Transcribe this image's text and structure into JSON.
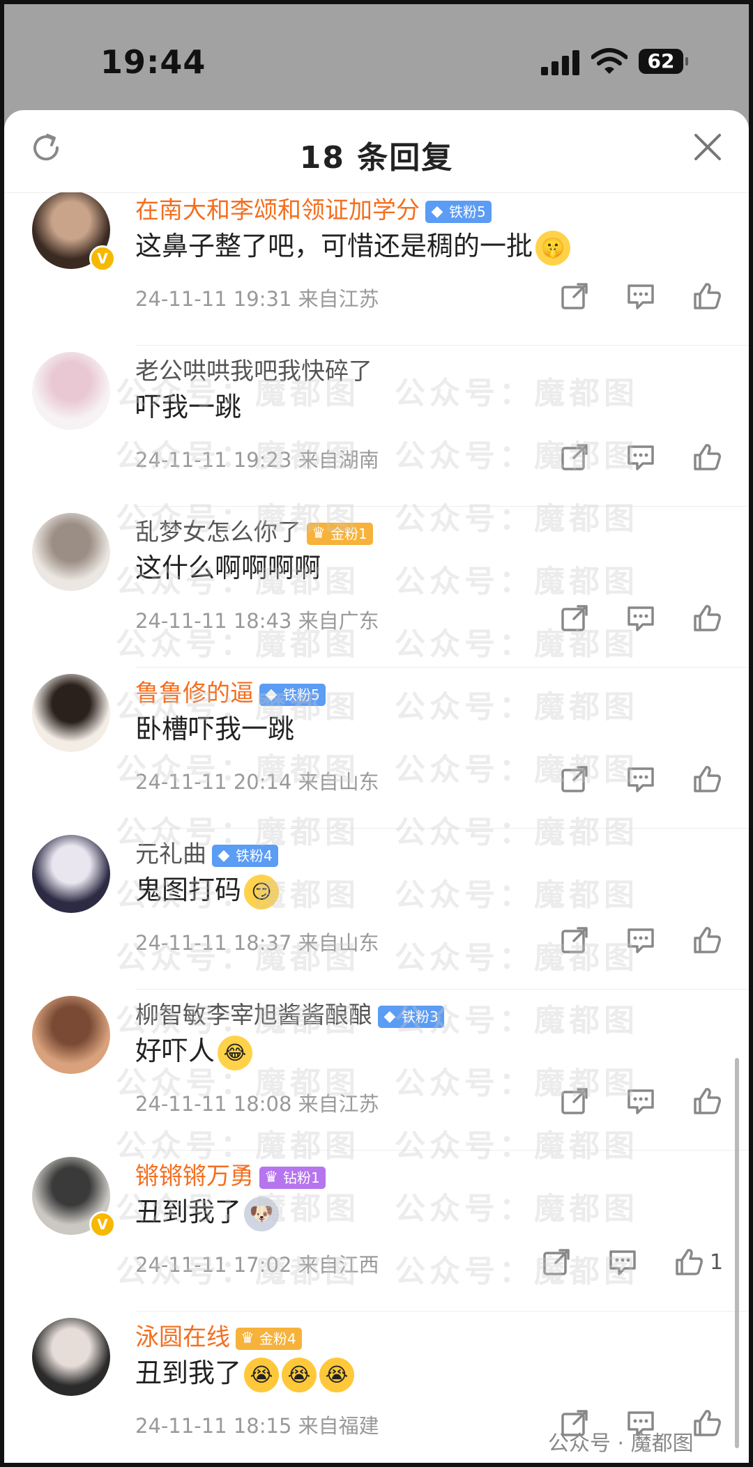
{
  "status_bar": {
    "time": "19:44",
    "battery": "62"
  },
  "sheet": {
    "title": "18 条回复"
  },
  "comments": [
    {
      "name": "在南大和李颂和领证加学分",
      "name_color": "orange",
      "badge": "铁粉5",
      "badge_style": "blue",
      "verified": true,
      "text": "这鼻子整了吧，可惜还是稠的一批",
      "emojis": [
        "shush-emoji"
      ],
      "time": "24-11-11 19:31",
      "location": "来自江苏",
      "likes": ""
    },
    {
      "name": "老公哄哄我吧我快碎了",
      "name_color": "gray",
      "badge": "",
      "badge_style": "",
      "verified": false,
      "text": "吓我一跳",
      "emojis": [],
      "time": "24-11-11 19:23",
      "location": "来自湖南",
      "likes": ""
    },
    {
      "name": "乱梦女怎么你了",
      "name_color": "gray",
      "badge": "金粉1",
      "badge_style": "gold",
      "verified": false,
      "text": "这什么啊啊啊啊",
      "emojis": [],
      "time": "24-11-11 18:43",
      "location": "来自广东",
      "likes": ""
    },
    {
      "name": "鲁鲁修的逼",
      "name_color": "orange",
      "badge": "铁粉5",
      "badge_style": "blue",
      "verified": false,
      "text": "卧槽吓我一跳",
      "emojis": [],
      "time": "24-11-11 20:14",
      "location": "来自山东",
      "likes": ""
    },
    {
      "name": "元礼曲",
      "name_color": "gray",
      "badge": "铁粉4",
      "badge_style": "blue",
      "verified": false,
      "text": "鬼图打码",
      "emojis": [
        "smirk-emoji"
      ],
      "time": "24-11-11 18:37",
      "location": "来自山东",
      "likes": ""
    },
    {
      "name": "柳智敏李宰旭酱酱酿酿",
      "name_color": "gray",
      "badge": "铁粉3",
      "badge_style": "blue",
      "verified": false,
      "text": "好吓人",
      "emojis": [
        "laugh-cry-emoji"
      ],
      "time": "24-11-11 18:08",
      "location": "来自江苏",
      "likes": ""
    },
    {
      "name": "锵锵锵万勇",
      "name_color": "orange",
      "badge": "钻粉1",
      "badge_style": "purple",
      "verified": true,
      "text": "丑到我了",
      "emojis": [
        "husky-emoji"
      ],
      "time": "24-11-11 17:02",
      "location": "来自江西",
      "likes": "1"
    },
    {
      "name": "泳圆在线",
      "name_color": "orange",
      "badge": "金粉4",
      "badge_style": "gold",
      "verified": false,
      "text": "丑到我了",
      "emojis": [
        "cry-emoji",
        "cry-emoji",
        "cry-emoji"
      ],
      "time": "24-11-11 18:15",
      "location": "来自福建",
      "likes": ""
    }
  ],
  "watermark": "公众号：魔都图",
  "footer_watermark": "公众号 · 魔都图"
}
